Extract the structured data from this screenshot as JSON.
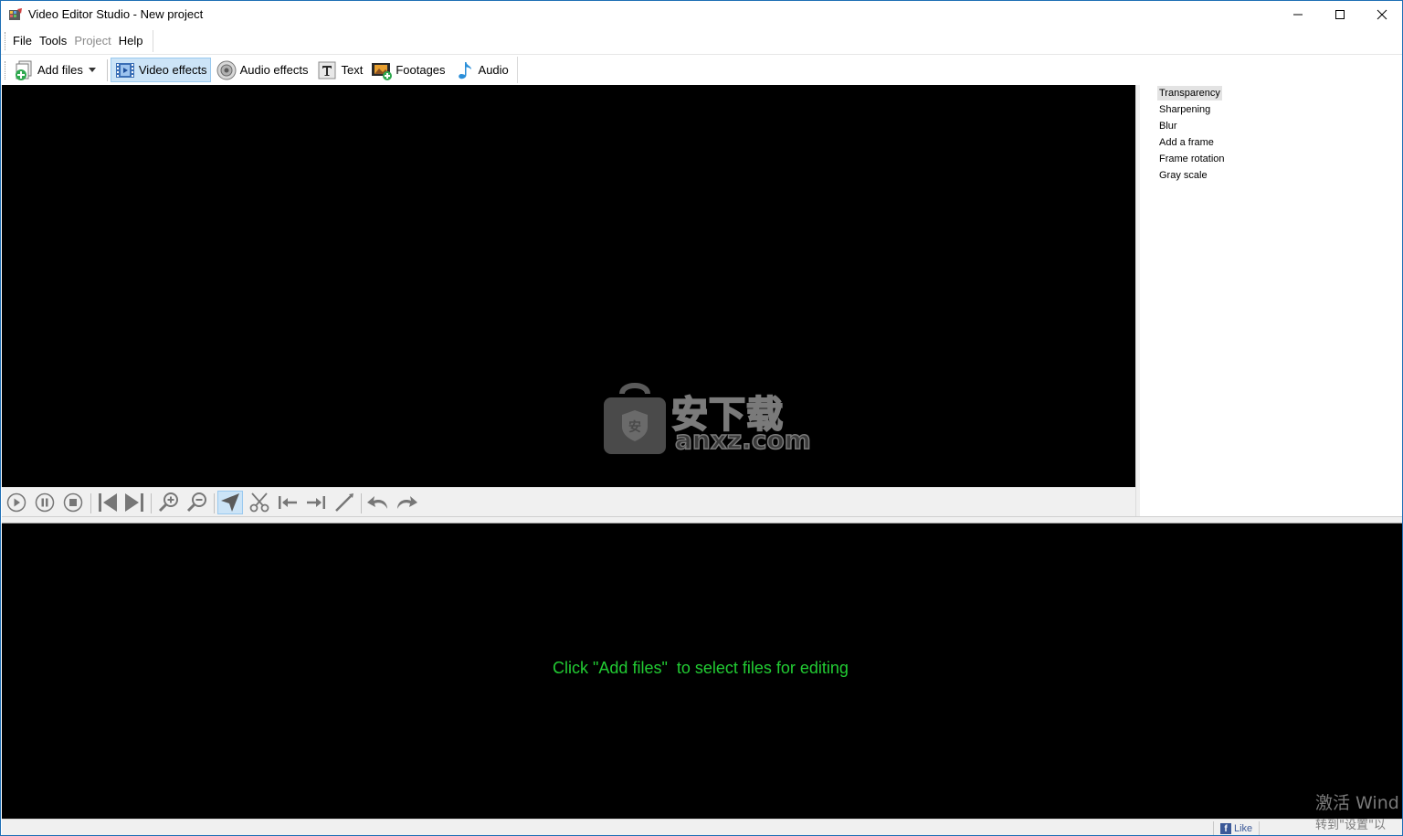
{
  "window": {
    "title": "Video Editor Studio - New project"
  },
  "menu": {
    "items": [
      {
        "label": "File",
        "enabled": true
      },
      {
        "label": "Tools",
        "enabled": true
      },
      {
        "label": "Project",
        "enabled": false
      },
      {
        "label": "Help",
        "enabled": true
      }
    ]
  },
  "toolbar": {
    "add_files": "Add files",
    "video_effects": "Video effects",
    "audio_effects": "Audio effects",
    "text": "Text",
    "footages": "Footages",
    "audio": "Audio",
    "active_tab": "Video effects"
  },
  "effects_panel": {
    "items": [
      "Transparency",
      "Sharpening",
      "Blur",
      "Add a frame",
      "Frame rotation",
      "Gray scale"
    ],
    "selected": "Transparency"
  },
  "preview": {
    "watermark_cn": "安下载",
    "watermark_en": "anxz.com"
  },
  "timeline": {
    "message": "Click \"Add files\"  to select files for editing"
  },
  "statusbar": {
    "like": "Like"
  },
  "os_overlay": {
    "line1": "激活 Wind",
    "line2": "转到\"设置\"以"
  },
  "colors": {
    "accent_selected": "#cce4f7",
    "timeline_text": "#22cc33",
    "preview_bg": "#000000"
  }
}
